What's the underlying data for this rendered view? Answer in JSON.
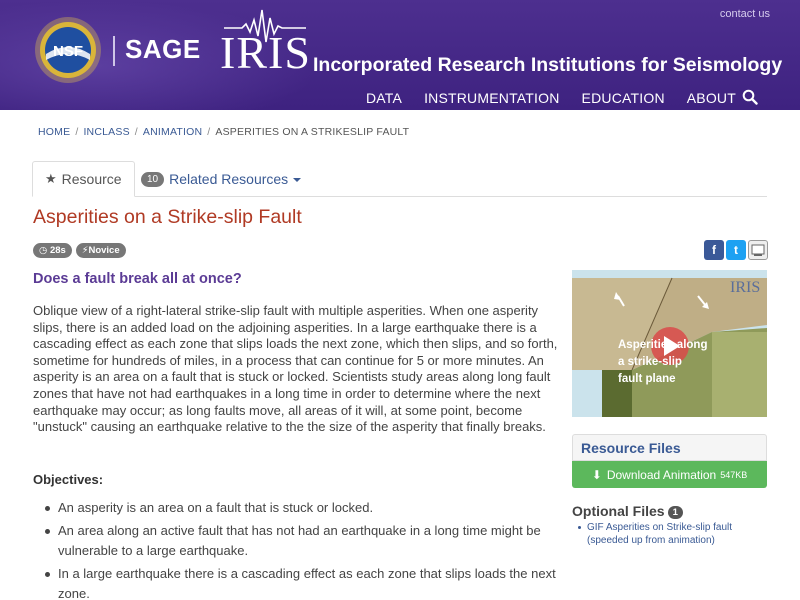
{
  "header": {
    "contact_label": "contact us",
    "nsf_text": "NSF",
    "sage_text": "SAGE",
    "iris_text": "IRIS",
    "iris_full_name": "Incorporated Research Institutions for Seismology",
    "nav": [
      "DATA",
      "INSTRUMENTATION",
      "EDUCATION",
      "ABOUT"
    ],
    "search_icon": "search-icon"
  },
  "breadcrumb": [
    "HOME",
    "INCLASS",
    "ANIMATION",
    "ASPERITIES ON A STRIKESLIP FAULT"
  ],
  "tabs": {
    "resource": "Resource",
    "related_count": "10",
    "related": "Related Resources"
  },
  "page": {
    "title": "Asperities on a Strike-slip Fault",
    "duration_badge": "28s",
    "level_badge": "Novice",
    "subtitle": "Does a fault break all at once?",
    "description": "Oblique view of a right-lateral strike-slip fault with multiple asperities. When one asperity slips, there is an added load on the adjoining asperities. In a large earthquake there is a cascading effect as each zone that slips loads the next zone, which then slips, and so forth, sometime for hundreds of miles, in a process that can continue for 5 or more minutes. An asperity is an area on a fault that is stuck or locked. Scientists study areas along long fault zones that have not had earthquakes in a long time in order to determine where the next earthquake may occur; as long faults move, all areas of it will, at some point, become \"unstuck\" causing an earthquake relative to the the size of the asperity that finally breaks.",
    "objectives_label": "Objectives:",
    "objectives": [
      "An asperity is an area on a fault that is stuck or locked.",
      "An area along an active fault that has not had an earthquake in a long time might be vulnerable to a large earthquake.",
      "In a large earthquake there is a cascading effect as each zone that slips loads the next zone."
    ]
  },
  "sidebar": {
    "share": {
      "facebook": "f",
      "twitter": "t"
    },
    "thumbnail": {
      "overlay_text": [
        "Asperities along",
        "a strike-slip",
        "fault plane"
      ],
      "logo": "IRIS"
    },
    "resource_files_label": "Resource Files",
    "download_label": "Download Animation",
    "download_size": "547KB",
    "optional_files_label": "Optional Files",
    "optional_count": "1",
    "optional_files": [
      "GIF Asperities on Strike-slip fault (speeded up from animation)"
    ]
  },
  "colors": {
    "header_bg": "#4a2c8c",
    "title": "#b03a24",
    "subtitle": "#5b3b95",
    "link": "#3a5a94",
    "download": "#5cb85c"
  }
}
